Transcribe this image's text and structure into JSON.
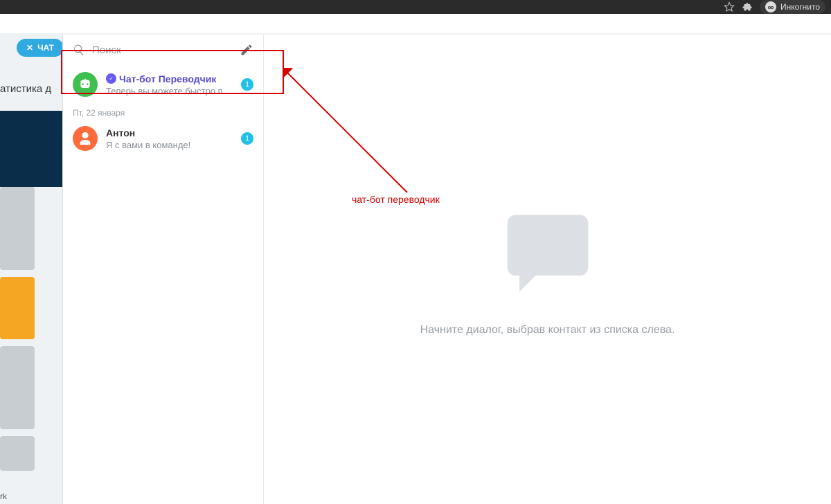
{
  "browser": {
    "incognito_label": "Инкогнито"
  },
  "background": {
    "chat_pill": "ЧАТ",
    "stats_label": "атистика д",
    "footer": "rk"
  },
  "sidebar": {
    "search_placeholder": "Поиск",
    "items": [
      {
        "title": "Чат-бот Переводчик",
        "preview": "Теперь вы можете быстро пере…",
        "unread": "1"
      },
      {
        "title": "Антон",
        "preview": "Я с вами в команде!",
        "unread": "1"
      }
    ],
    "date_separator": "Пт, 22 января"
  },
  "main": {
    "empty_text": "Начните диалог, выбрав контакт из списка слева."
  },
  "annotation": {
    "label": "чат-бот переводчик"
  }
}
